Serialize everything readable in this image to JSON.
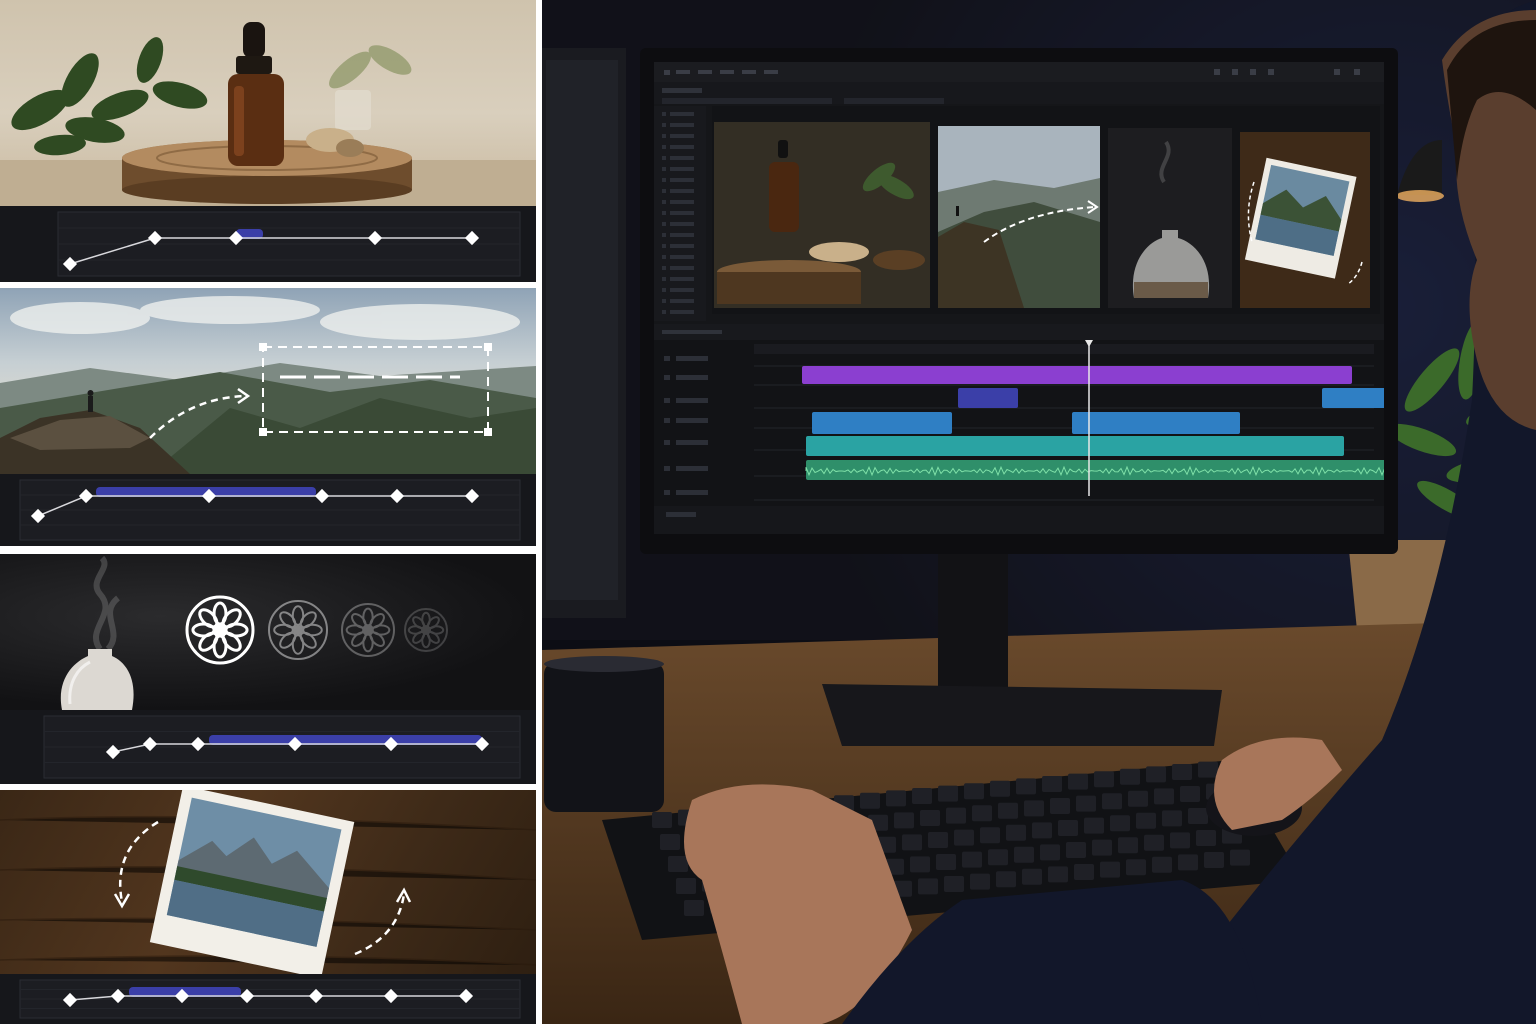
{
  "colors": {
    "keyframe_bar": "#3b3fa8",
    "track_purple": "#8b3fd0",
    "track_blue": "#2f7fc4",
    "track_teal": "#2aa3a3",
    "track_audio": "#2f8f6a",
    "playhead": "#e8e8e8"
  },
  "icons": [
    "dropper-bottle-icon",
    "mountain-hiker-icon",
    "diffuser-icon",
    "flower-mandala-icon",
    "photo-print-icon",
    "keyframe-diamond-icon",
    "motion-path-arrow-icon",
    "playhead-icon"
  ],
  "timelines": {
    "panel1": {
      "keyframes": [
        0.13,
        0.29,
        0.44,
        0.7,
        0.88
      ],
      "bar": [
        0.44,
        0.49
      ]
    },
    "panel2": {
      "keyframes": [
        0.07,
        0.16,
        0.39,
        0.6,
        0.74,
        0.88
      ],
      "bar": [
        0.18,
        0.59
      ]
    },
    "panel3": {
      "keyframes": [
        0.21,
        0.28,
        0.37,
        0.55,
        0.73,
        0.9
      ],
      "bar": [
        0.39,
        0.9
      ]
    },
    "panel4": {
      "keyframes": [
        0.13,
        0.22,
        0.34,
        0.46,
        0.59,
        0.73,
        0.87
      ],
      "bar": [
        0.24,
        0.45
      ]
    }
  },
  "editor": {
    "playhead_position": 0.54
  }
}
